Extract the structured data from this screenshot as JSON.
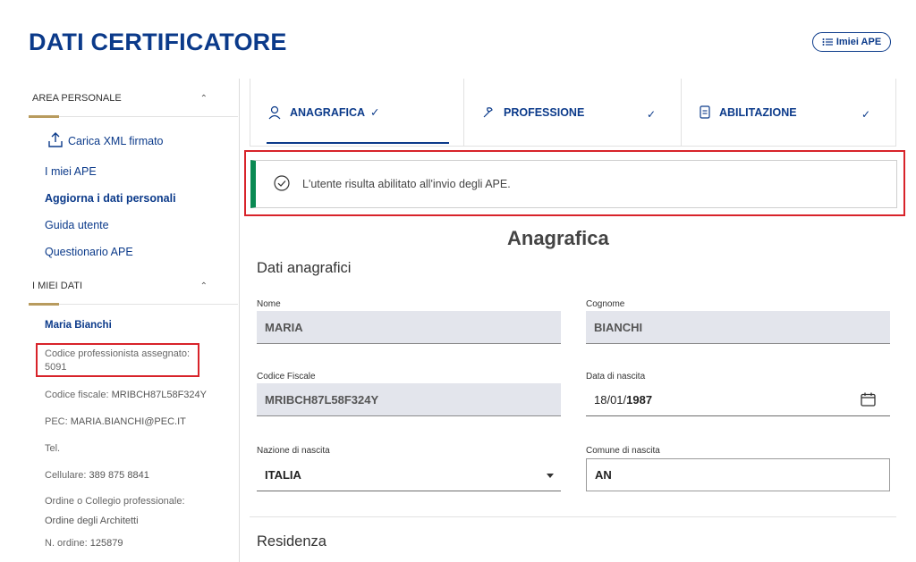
{
  "page": {
    "title": "DATI CERTIFICATORE",
    "imiei_ape_button": "Imiei APE"
  },
  "sidebar": {
    "area_personale": "AREA PERSONALE",
    "carica_xml": "Carica XML firmato",
    "links": [
      "I miei APE",
      "Aggiorna i dati personali",
      "Guida utente",
      "Questionario APE"
    ],
    "i_miei_dati": "I MIEI DATI",
    "user_name": "Maria Bianchi",
    "codice_professionista": "Codice professionista assegnato: 5091",
    "codice_fiscale_label": "Codice fiscale:",
    "codice_fiscale_value": "MRIBCH87L58F324Y",
    "pec_label": "PEC:",
    "pec_value": "MARIA.BIANCHI@PEC.IT",
    "tel_label": "Tel.",
    "cellulare_label": "Cellulare:",
    "cellulare_value": "389 875 8841",
    "ordine_label": "Ordine o Collegio professionale:",
    "ordine_value": "Ordine degli Architetti",
    "n_ordine_label": "N. ordine:",
    "n_ordine_value": "125879"
  },
  "tabs": [
    {
      "label": "ANAGRAFICA",
      "icon": "user-icon",
      "active": true
    },
    {
      "label": "PROFESSIONE",
      "icon": "tools-icon",
      "active": false
    },
    {
      "label": "ABILITAZIONE",
      "icon": "document-icon",
      "active": false
    }
  ],
  "alert": {
    "message": "L'utente risulta abilitato all'invio degli APE.",
    "color": "#0a8a53"
  },
  "main": {
    "section_title": "Anagrafica",
    "dati_anagrafici": "Dati anagrafici",
    "residenza": "Residenza",
    "fields": {
      "nome_label": "Nome",
      "nome_value": "MARIA",
      "cognome_label": "Cognome",
      "cognome_value": "BIANCHI",
      "cf_label": "Codice Fiscale",
      "cf_value": "MRIBCH87L58F324Y",
      "dn_label": "Data di nascita",
      "dn_value_prefix": "18/01/",
      "dn_value_year": "1987",
      "nazione_label": "Nazione di nascita",
      "nazione_value": "ITALIA",
      "comune_label": "Comune di nascita",
      "comune_value": "AN"
    }
  },
  "colors": {
    "brand": "#0b3a8a",
    "highlight_red": "#d8232a",
    "accent_gold": "#b89b5e"
  }
}
